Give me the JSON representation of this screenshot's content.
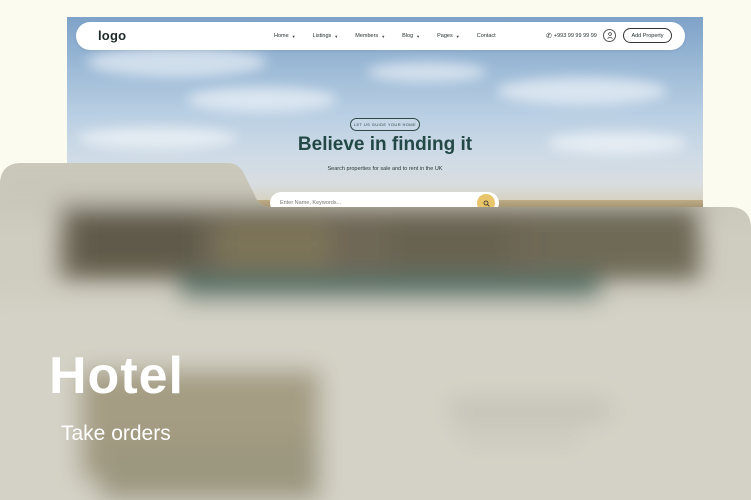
{
  "preview": {
    "logo": "logo",
    "nav": [
      {
        "label": "Home",
        "dropdown": true
      },
      {
        "label": "Listings",
        "dropdown": true
      },
      {
        "label": "Members",
        "dropdown": true
      },
      {
        "label": "Blog",
        "dropdown": true
      },
      {
        "label": "Pages",
        "dropdown": true
      },
      {
        "label": "Contact",
        "dropdown": false
      }
    ],
    "phone": "+993 99 99 99 99",
    "add_property": "Add Property",
    "badge": "LET US GUIDE YOUR HOME",
    "title": "Believe in finding it",
    "subtitle": "Search properties for sale and to rent in the UK",
    "search_placeholder": "Enter Name, Keywords...",
    "icons": {
      "phone": "phone-icon",
      "user": "user-icon",
      "search": "search-icon",
      "caret": "chevron-down-icon"
    }
  },
  "caption": {
    "title": "Hotel",
    "subtitle": "Take orders"
  },
  "colors": {
    "page_background": "#fbfbef",
    "hero_title": "#234845",
    "search_button": "#e8c46a",
    "caption_text": "#ffffff"
  }
}
